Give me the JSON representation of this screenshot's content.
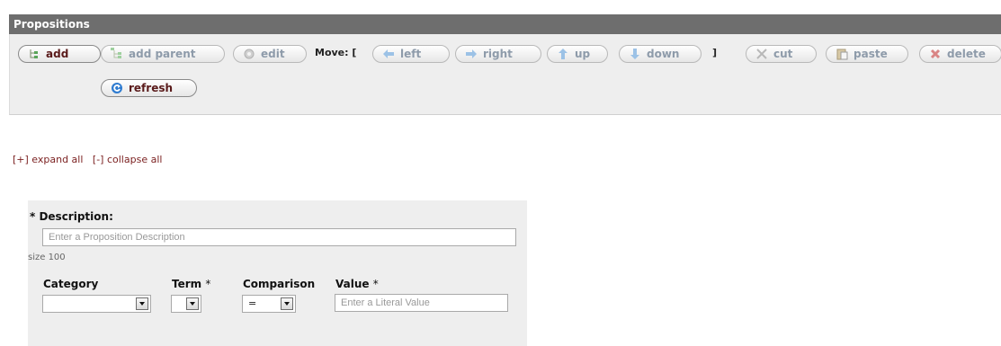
{
  "header": {
    "title": "Propositions"
  },
  "toolbar": {
    "add": "add",
    "add_parent": "add parent",
    "edit": "edit",
    "move_label": "Move: [",
    "left": "left",
    "right": "right",
    "up": "up",
    "down": "down",
    "close_bracket": "]",
    "cut": "cut",
    "paste": "paste",
    "delete": "delete",
    "refresh": "refresh"
  },
  "tree_links": {
    "expand_all": "[+] expand all",
    "collapse_all": "[-] collapse all"
  },
  "form": {
    "description_label": "* Description:",
    "description_placeholder": "Enter a Proposition Description",
    "size_hint": "size 100",
    "category_label": "Category",
    "term_label": "Term",
    "term_required": "*",
    "comparison_label": "Comparison",
    "comparison_value": "=",
    "value_label": "Value",
    "value_required": "*",
    "value_placeholder": "Enter a Literal Value"
  },
  "colors": {
    "header_bg": "#6e6e6e",
    "link": "#7a1f1f",
    "enabled_text": "#5a1b1b",
    "disabled_text": "#8e9baa"
  }
}
